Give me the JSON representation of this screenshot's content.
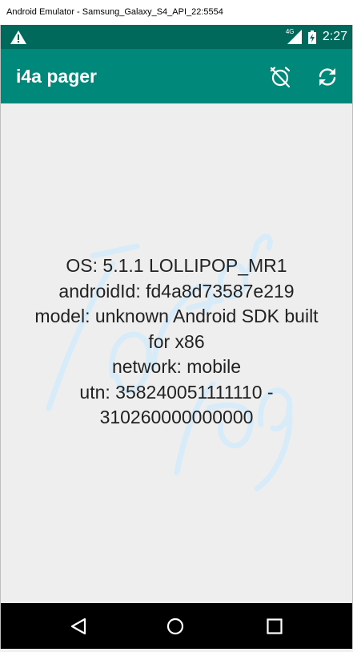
{
  "window": {
    "title": "Android Emulator - Samsung_Galaxy_S4_API_22:5554"
  },
  "status_bar": {
    "warning_icon": "warning-icon",
    "network_type": "4G",
    "time": "2:27",
    "background": "#00695c"
  },
  "app_bar": {
    "title": "i4a pager",
    "actions": [
      {
        "icon": "alarm-off-icon"
      },
      {
        "icon": "refresh-icon"
      }
    ],
    "background": "#00897b"
  },
  "content": {
    "watermark_text": "i4a for dy",
    "info_lines": [
      "OS: 5.1.1 LOLLIPOP_MR1",
      "androidId: fd4a8d73587e219",
      "model: unknown Android SDK built",
      "for x86",
      "network: mobile",
      "utn: 358240051111110 -",
      "310260000000000"
    ],
    "background": "#eeeeee"
  },
  "nav_bar": {
    "buttons": [
      {
        "icon": "back-icon"
      },
      {
        "icon": "home-icon"
      },
      {
        "icon": "recents-icon"
      }
    ]
  }
}
